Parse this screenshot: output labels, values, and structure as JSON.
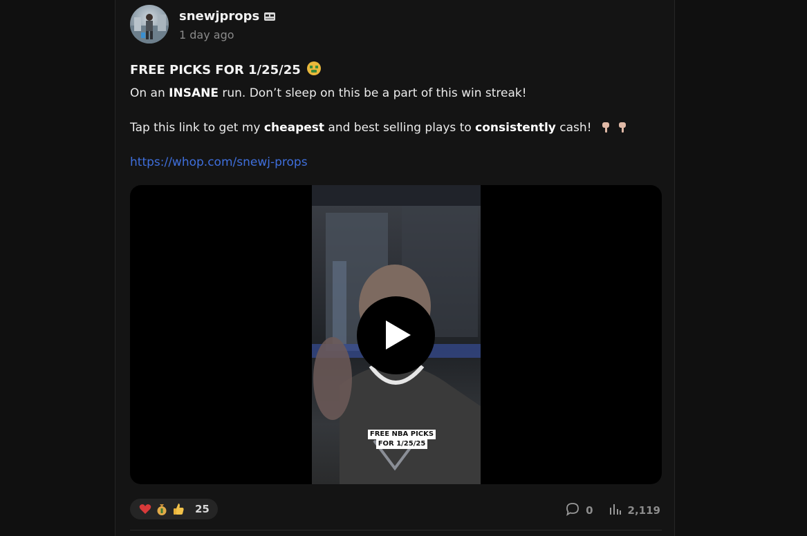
{
  "post": {
    "author": "snewjprops",
    "timestamp": "1 day ago",
    "title": "FREE PICKS FOR 1/25/25",
    "line1": {
      "pre": "On an ",
      "bold": "INSANE",
      "post": " run. Don’t sleep on this be a part of this win streak!"
    },
    "line2": {
      "pre": "Tap this link to get my ",
      "bold1": "cheapest",
      "mid": " and best selling plays to ",
      "bold2": "consistently",
      "post": " cash!"
    },
    "link": "https://whop.com/snewj-props",
    "video": {
      "caption_line1": "FREE NBA PICKS",
      "caption_line2": "FOR 1/25/25"
    },
    "reactions": {
      "emojis": [
        "heart-emoji",
        "money-bag-emoji",
        "thumbs-up-emoji"
      ],
      "count": "25"
    },
    "comments": "0",
    "views": "2,119"
  },
  "colors": {
    "background": "#101010",
    "card": "#141414",
    "link": "#3f6fdc",
    "muted": "#8a8a8a"
  }
}
